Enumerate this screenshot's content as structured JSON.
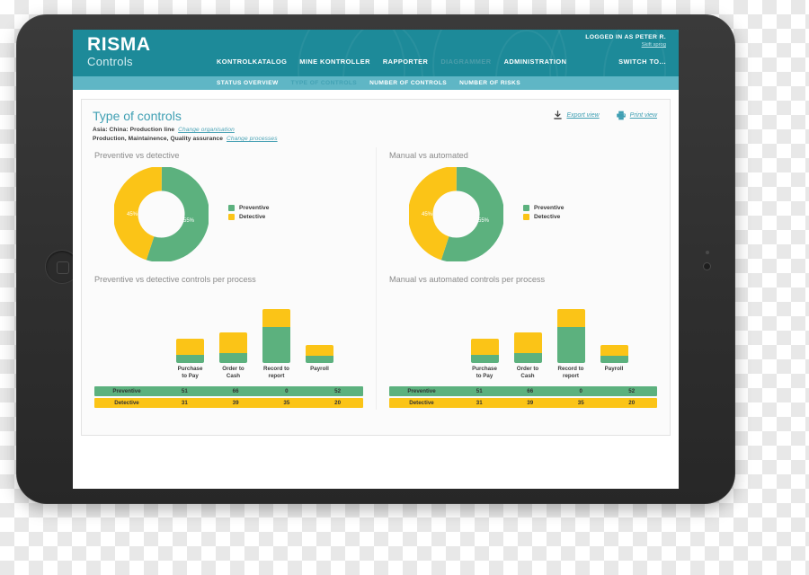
{
  "brand": {
    "name": "RISMA",
    "product": "Controls",
    "accent_teal": "#1d8a99",
    "accent_subnav": "#5fb6c5",
    "green": "#5cb17e",
    "yellow": "#fbc417"
  },
  "header": {
    "user_status": "LOGGED IN AS PETER R.",
    "language_link": "Skift sprog",
    "switch_to": "SWITCH TO...",
    "nav": [
      {
        "label": "KONTROLKATALOG",
        "active": false
      },
      {
        "label": "MINE KONTROLLER",
        "active": false
      },
      {
        "label": "RAPPORTER",
        "active": false
      },
      {
        "label": "DIAGRAMMER",
        "active": true
      },
      {
        "label": "ADMINISTRATION",
        "active": false
      }
    ],
    "subnav": [
      {
        "label": "STATUS OVERVIEW",
        "active": false
      },
      {
        "label": "TYPE OF CONTROLS",
        "active": true
      },
      {
        "label": "NUMBER OF CONTROLS",
        "active": false
      },
      {
        "label": "NUMBER OF RISKS",
        "active": false
      }
    ]
  },
  "page": {
    "title": "Type of controls",
    "organisation": "Asia: China: Production line",
    "organisation_link": "Change organisation",
    "processes": "Production, Maintainence, Quality assurance",
    "processes_link": "Change processes",
    "export_label": "Export view",
    "print_label": "Print view"
  },
  "chart_data": [
    {
      "type": "pie",
      "title": "Preventive vs detective",
      "labels": [
        "Preventive",
        "Detective"
      ],
      "values": [
        55,
        45
      ],
      "value_labels": [
        "55%",
        "45%"
      ],
      "colors": [
        "#5cb17e",
        "#fbc417"
      ],
      "legend": "right",
      "donut": true
    },
    {
      "type": "pie",
      "title": "Manual vs automated",
      "labels": [
        "Preventive",
        "Detective"
      ],
      "values": [
        55,
        45
      ],
      "value_labels": [
        "55%",
        "45%"
      ],
      "colors": [
        "#5cb17e",
        "#fbc417"
      ],
      "legend": "right",
      "donut": true
    },
    {
      "type": "bar",
      "title": "Preventive vs detective controls per process",
      "categories": [
        "Purchase to Pay",
        "Order to Cash",
        "Record to report",
        "Payroll"
      ],
      "series": [
        {
          "name": "Preventive",
          "values": [
            51,
            66,
            0,
            52
          ],
          "color": "#5cb17e"
        },
        {
          "name": "Detective",
          "values": [
            31,
            39,
            35,
            20
          ],
          "color": "#fbc417"
        }
      ],
      "stacked": true,
      "grid": false,
      "ylabel": "",
      "xlabel": ""
    },
    {
      "type": "bar",
      "title": "Manual vs automated controls per process",
      "categories": [
        "Purchase to Pay",
        "Order to Cash",
        "Record to report",
        "Payroll"
      ],
      "series": [
        {
          "name": "Preventive",
          "values": [
            51,
            66,
            0,
            52
          ],
          "color": "#5cb17e"
        },
        {
          "name": "Detective",
          "values": [
            31,
            39,
            35,
            20
          ],
          "color": "#fbc417"
        }
      ],
      "stacked": true,
      "grid": false,
      "ylabel": "",
      "xlabel": ""
    }
  ],
  "bar_labels": {
    "l0": [
      "Purchase",
      "to Pay"
    ],
    "l1": [
      "Order to Cash",
      ""
    ],
    "l2": [
      "Record to",
      "report"
    ],
    "l3": [
      "Payroll",
      ""
    ]
  }
}
